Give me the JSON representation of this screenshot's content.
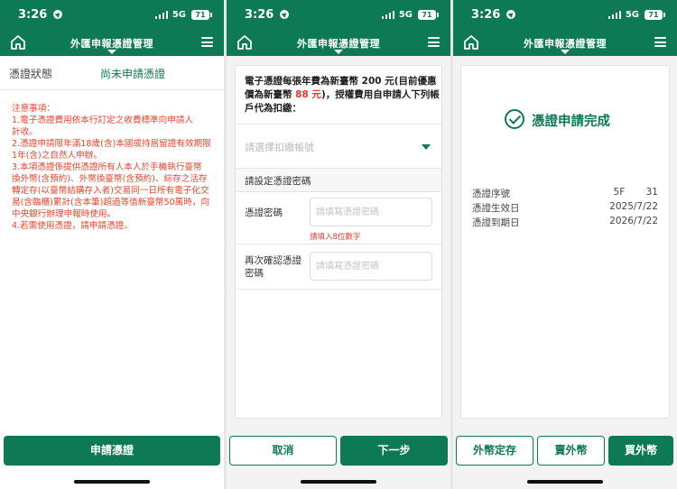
{
  "status_bar": {
    "time": "3:26",
    "network": "5G",
    "battery": "71"
  },
  "nav": {
    "title": "外匯申報憑證管理"
  },
  "screen1": {
    "status_label": "憑證狀態",
    "status_value": "尚未申請憑證",
    "notes": [
      "注意事項：",
      "1.電子憑證費用依本行訂定之收費標準向申請人",
      "計收。",
      "2.憑證申請限年滿18歲(含)本國或持居留證有效期限",
      "1年(含)之自然人申辦。",
      "3.本項憑證係提供憑證所有人本人於手機執行臺幣",
      "換外幣(含預約)、外幣換臺幣(含預約)、綜存之活存",
      "轉定存(以臺幣結購存入者)交易同一日所有電子化交",
      "易(含臨櫃)累計(含本筆)超過等值新臺幣50萬時，向",
      "中央銀行辦理申報時使用。",
      "4.若需使用憑證，請申請憑證。"
    ],
    "apply_button": "申請憑證"
  },
  "screen2": {
    "fee_text_1": "電子憑證每張年費為新臺幣 200 元(目前優惠價為新臺幣 ",
    "fee_price": "88 元",
    "fee_text_2": ")，授權費用自申請人下列帳戶代為扣繳：",
    "account_placeholder": "請選擇扣繳帳號",
    "section_title": "請設定憑證密碼",
    "password_label": "憑證密碼",
    "password_placeholder": "請填寫憑證密碼",
    "password_hint": "請填入8位數字",
    "confirm_label_1": "再次確認憑證",
    "confirm_label_2": "密碼",
    "confirm_placeholder": "請填寫憑證密碼",
    "cancel_button": "取消",
    "next_button": "下一步"
  },
  "screen3": {
    "done_title": "憑證申請完成",
    "rows": [
      {
        "label": "憑證序號",
        "value": "5F       31"
      },
      {
        "label": "憑證生效日",
        "value": "2025/7/22"
      },
      {
        "label": "憑證到期日",
        "value": "2026/7/22"
      }
    ],
    "btn_fx_deposit": "外幣定存",
    "btn_sell_fx": "賣外幣",
    "btn_buy_fx": "買外幣"
  },
  "colors": {
    "brand_green": "#0e7a55",
    "alert_red": "#e8452d"
  },
  "icons": [
    "home-icon",
    "menu-icon",
    "location-arrow-icon",
    "signal-icon",
    "battery-icon",
    "dropdown-caret-icon",
    "check-circle-icon"
  ]
}
